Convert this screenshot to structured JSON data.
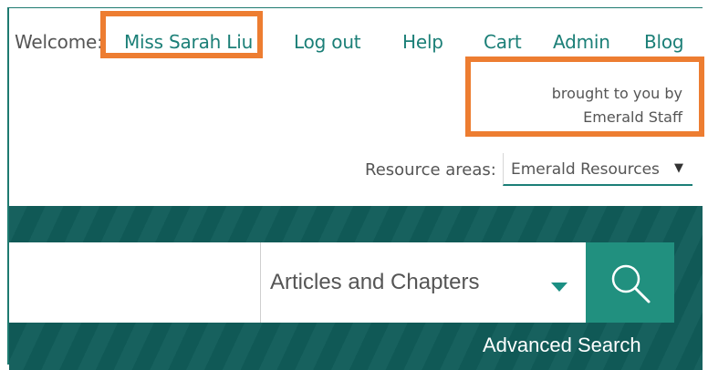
{
  "header": {
    "welcome_label": "Welcome:",
    "user_name": "Miss Sarah Liu",
    "links": {
      "logout": "Log out",
      "help": "Help",
      "cart": "Cart",
      "admin": "Admin",
      "blog": "Blog"
    },
    "brought_line1": "brought to you by",
    "brought_line2": "Emerald Staff"
  },
  "resource_areas": {
    "label": "Resource areas:",
    "selected": "Emerald Resources"
  },
  "search": {
    "query": "",
    "scope_selected": "Articles and Chapters",
    "advanced_label": "Advanced Search",
    "button_icon": "search-icon"
  },
  "colors": {
    "brand_teal": "#1b7f77",
    "band_dark": "#105c59",
    "search_button": "#21907f",
    "highlight": "#ed7d31"
  }
}
